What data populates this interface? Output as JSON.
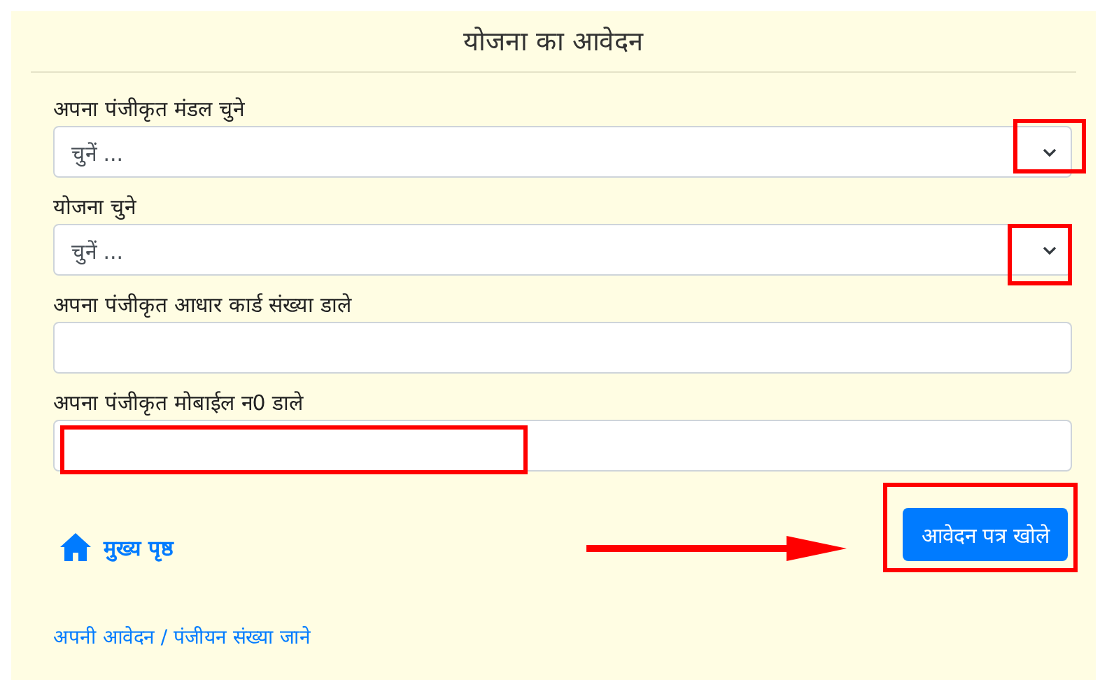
{
  "title": "योजना का आवेदन",
  "fields": [
    {
      "kind": "select",
      "label": "अपना पंजीकृत मंडल चुने",
      "value": "चुनें ...",
      "marked": true
    },
    {
      "kind": "select",
      "label": "योजना चुने",
      "value": "चुनें ...",
      "marked": true
    },
    {
      "kind": "input",
      "label": "अपना पंजीकृत आधार कार्ड संख्या डाले",
      "marked": false
    },
    {
      "kind": "input",
      "label": "अपना पंजीकृत मोबाईल न0 डाले",
      "marked": true
    }
  ],
  "home_link": "मुख्य पृष्ठ",
  "submit": {
    "label": "आवेदन पत्र खोले",
    "marked": true,
    "arrow": true
  },
  "footer_link": "अपनी आवेदन / पंजीयन संख्या जाने"
}
